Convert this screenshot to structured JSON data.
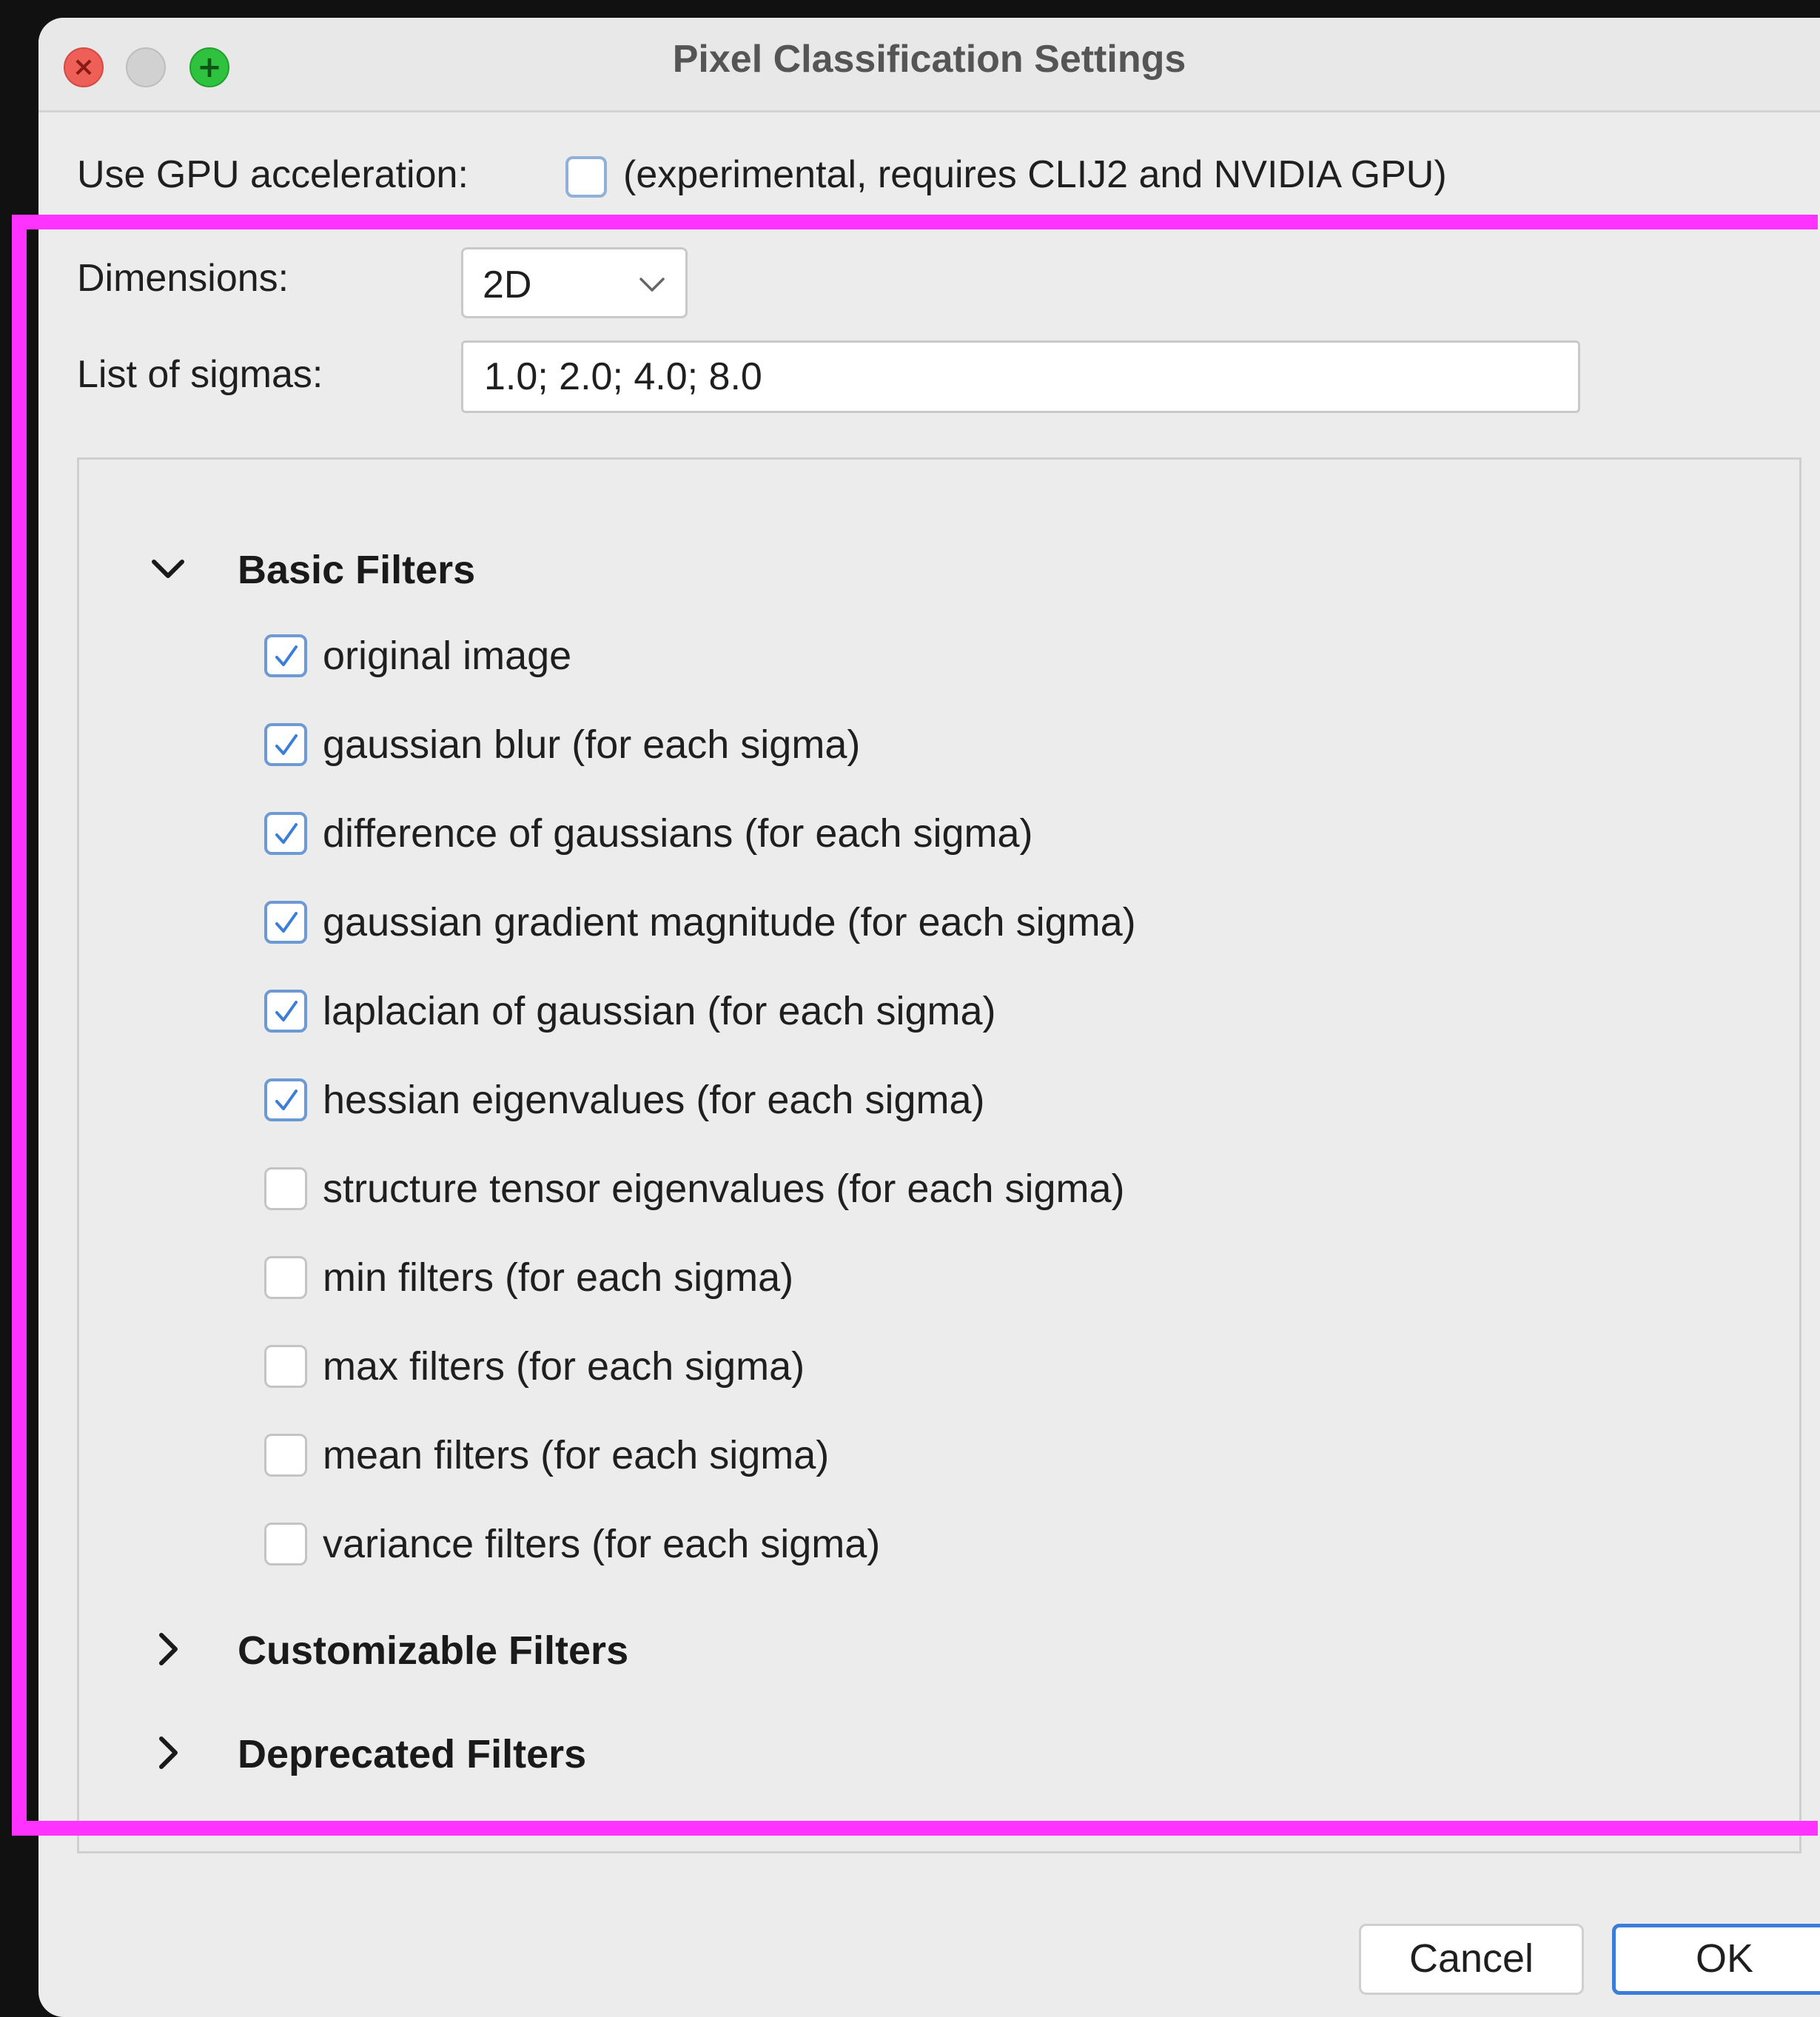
{
  "window": {
    "title": "Pixel Classification Settings"
  },
  "gpu": {
    "label": "Use GPU acceleration:",
    "note": "(experimental, requires CLIJ2 and NVIDIA GPU)",
    "checked": false
  },
  "dimensions": {
    "label": "Dimensions:",
    "value": "2D"
  },
  "sigmas": {
    "label": "List of sigmas:",
    "value": "1.0; 2.0; 4.0; 8.0"
  },
  "groups": {
    "basic": {
      "title": "Basic Filters",
      "expanded": true
    },
    "customizable": {
      "title": "Customizable Filters",
      "expanded": false
    },
    "deprecated": {
      "title": "Deprecated Filters",
      "expanded": false
    }
  },
  "filters": [
    {
      "label": "original image",
      "checked": true
    },
    {
      "label": "gaussian blur (for each sigma)",
      "checked": true
    },
    {
      "label": "difference of gaussians (for each sigma)",
      "checked": true
    },
    {
      "label": "gaussian gradient magnitude (for each sigma)",
      "checked": true
    },
    {
      "label": "laplacian of gaussian (for each sigma)",
      "checked": true
    },
    {
      "label": "hessian eigenvalues (for each sigma)",
      "checked": true
    },
    {
      "label": "structure tensor eigenvalues (for each sigma)",
      "checked": false
    },
    {
      "label": "min filters (for each sigma)",
      "checked": false
    },
    {
      "label": "max filters (for each sigma)",
      "checked": false
    },
    {
      "label": "mean filters (for each sigma)",
      "checked": false
    },
    {
      "label": "variance filters (for each sigma)",
      "checked": false
    }
  ],
  "buttons": {
    "cancel": "Cancel",
    "ok": "OK"
  },
  "icons": {
    "close": "close-icon",
    "minimize": "minimize-icon",
    "zoom": "zoom-icon",
    "dropdown": "chevron-down-icon",
    "expanded": "chevron-down-icon",
    "collapsed": "chevron-right-icon",
    "check": "checkmark-icon"
  },
  "colors": {
    "highlight": "#ff33ff",
    "accent": "#3b7dd8",
    "close": "#ee5f58",
    "zoom": "#2fc23f"
  }
}
